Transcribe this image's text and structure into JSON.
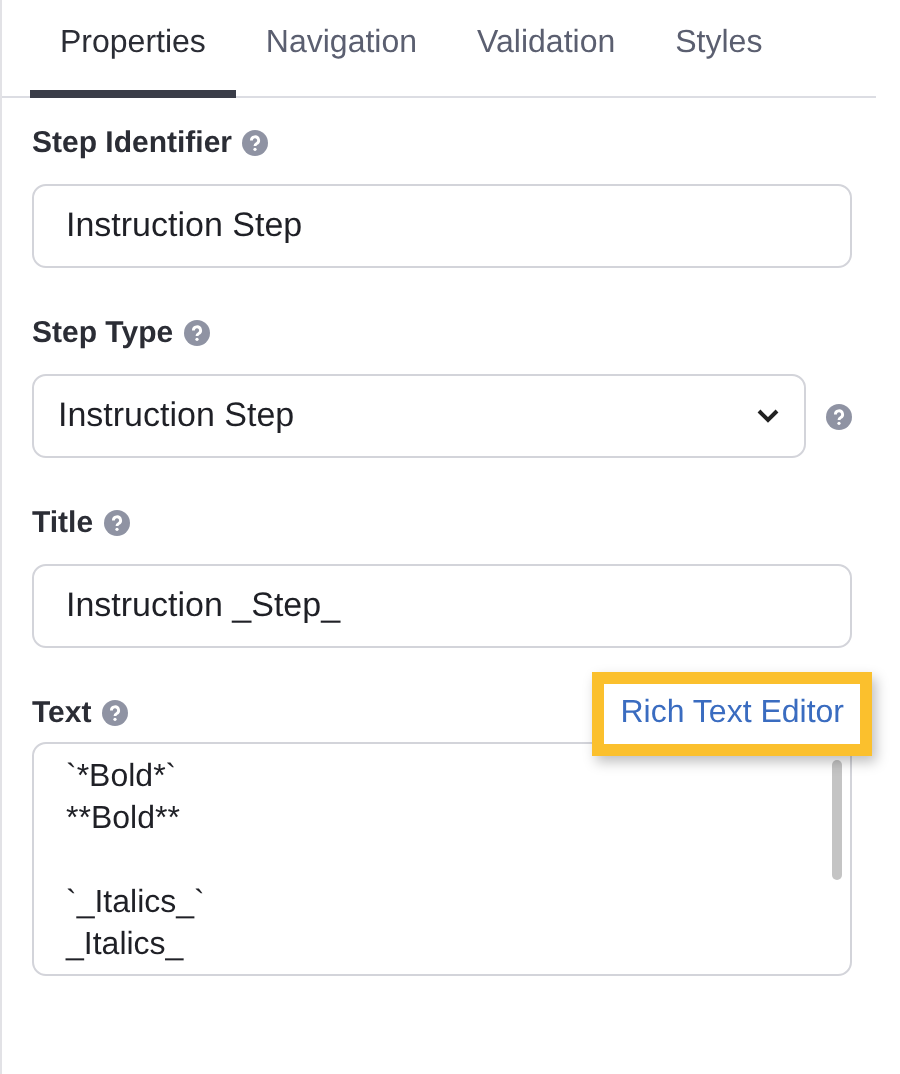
{
  "tabs": [
    {
      "label": "Properties",
      "selected": true
    },
    {
      "label": "Navigation",
      "selected": false
    },
    {
      "label": "Validation",
      "selected": false
    },
    {
      "label": "Styles",
      "selected": false
    }
  ],
  "fields": [
    {
      "kind": "input",
      "label": "Step Identifier",
      "value": "Instruction Step"
    },
    {
      "kind": "select",
      "label": "Step Type",
      "value": "Instruction Step"
    },
    {
      "kind": "input",
      "label": "Title",
      "value": "Instruction _Step_"
    },
    {
      "kind": "textarea",
      "label": "Text",
      "link": {
        "label": "Rich Text Editor",
        "highlighted": true
      },
      "paragraphs": [
        [
          "`*Bold*`",
          "**Bold**"
        ],
        [
          "`_Italics_`",
          "_Italics_"
        ]
      ]
    }
  ]
}
